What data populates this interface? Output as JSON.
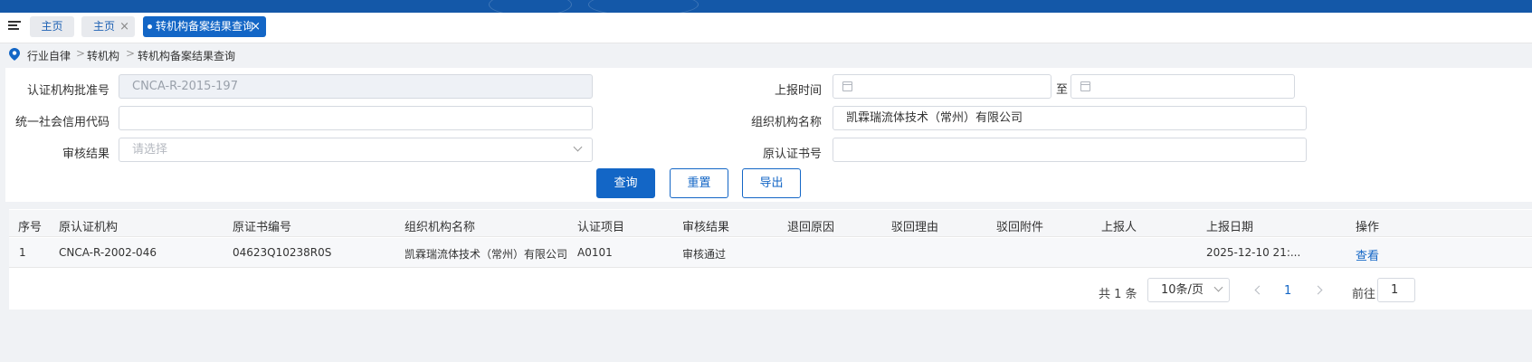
{
  "tabs": [
    {
      "label": "主页",
      "closable": false
    },
    {
      "label": "主页",
      "closable": true
    },
    {
      "label": "转机构备案结果查询",
      "closable": true,
      "active": true
    }
  ],
  "tab_close_glyph": "×",
  "breadcrumb": [
    "行业自律",
    "转机构",
    "转机构备案结果查询"
  ],
  "breadcrumb_sep": ">",
  "filters": {
    "cert_no": {
      "label": "认证机构批准号",
      "value": "CNCA-R-2015-197"
    },
    "credit_code": {
      "label": "统一社会信用代码",
      "value": ""
    },
    "review_result": {
      "label": "审核结果",
      "placeholder": "请选择"
    },
    "report_time": {
      "label": "上报时间",
      "to_label": "至"
    },
    "org_name": {
      "label": "组织机构名称",
      "value": "凯霖瑞流体技术（常州）有限公司"
    },
    "orig_cert_no": {
      "label": "原认证书号",
      "value": ""
    }
  },
  "buttons": {
    "query": "查询",
    "reset": "重置",
    "export": "导出"
  },
  "table": {
    "columns": [
      "序号",
      "原认证机构",
      "原证书编号",
      "组织机构名称",
      "认证项目",
      "审核结果",
      "退回原因",
      "驳回理由",
      "驳回附件",
      "上报人",
      "上报日期",
      "操作"
    ],
    "rows": [
      {
        "seq": "1",
        "orig_org": "CNCA-R-2002-046",
        "orig_cert_no": "04623Q10238R0S",
        "org_name": "凯霖瑞流体技术（常州）有限公司",
        "cert_item": "A0101",
        "review_result": "审核通过",
        "return_reason": "",
        "reject_reason": "",
        "reject_attachment": "",
        "reporter": "",
        "report_date": "2025-12-10 21:...",
        "action": "查看"
      }
    ]
  },
  "pagination": {
    "total": "共 1 条",
    "page_size": "10条/页",
    "current_page": "1",
    "jump_label": "前往",
    "jump_value": "1"
  },
  "colors": {
    "brand": "#1366c6",
    "topbar": "#1458a8"
  }
}
